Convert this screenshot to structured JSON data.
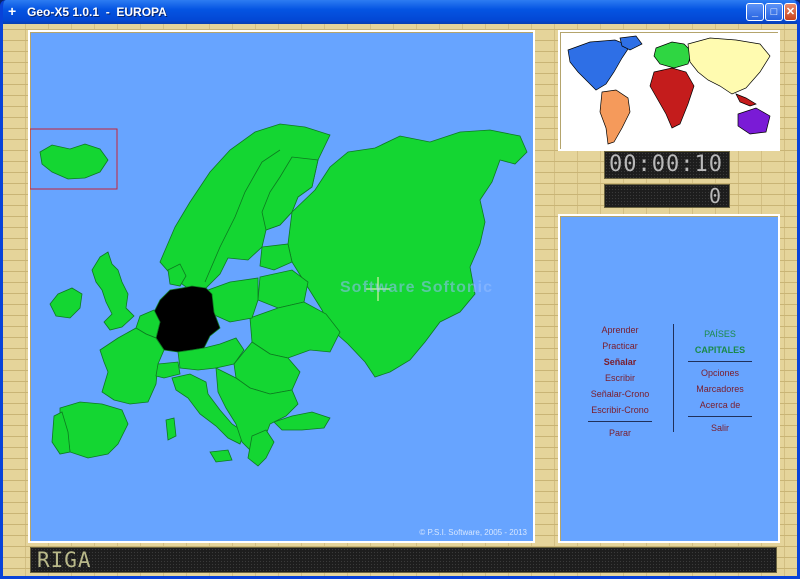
{
  "window": {
    "title": "Geo-X5 1.0.1  -  EUROPA",
    "minimize": "_",
    "maximize": "□",
    "close": "✕"
  },
  "map": {
    "region": "EUROPA",
    "highlighted_country": "Germany",
    "copyright": "© P.S.I. Software, 2005 - 2013",
    "watermark": "Software Softonic"
  },
  "timer": "00:00:10",
  "score": "0",
  "answer_display": "RIGA",
  "menu": {
    "left": [
      {
        "label": "Aprender"
      },
      {
        "label": "Practicar"
      },
      {
        "label": "Señalar",
        "active": true
      },
      {
        "label": "Escribir"
      },
      {
        "label": "Señalar-Crono"
      },
      {
        "label": "Escribir-Crono"
      },
      {
        "label": "Parar"
      }
    ],
    "right": [
      {
        "label": "PAÍSES"
      },
      {
        "label": "CAPITALES"
      },
      {
        "label": "Opciones"
      },
      {
        "label": "Marcadores"
      },
      {
        "label": "Acerca de"
      },
      {
        "label": "Salir"
      }
    ]
  },
  "colors": {
    "ocean": "#67a4ff",
    "land": "#14d632",
    "highlight": "#000000",
    "iceland_box": "#c4243a",
    "world_north_america": "#2e6fe6",
    "world_south_america": "#f59a5b",
    "world_europe": "#2fd642",
    "world_africa": "#c41c1c",
    "world_asia": "#fffbb0",
    "world_oceania": "#7a1bd6"
  }
}
